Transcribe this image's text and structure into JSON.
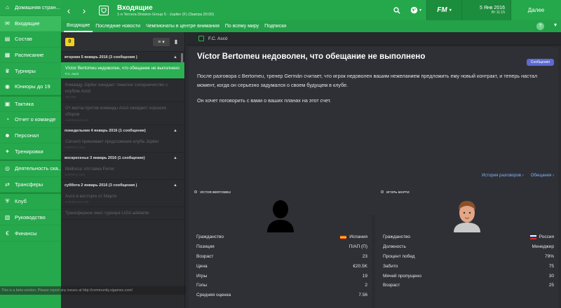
{
  "sidebar": {
    "items": [
      {
        "label": "Домашняя стран...",
        "icon": "home-icon",
        "glyph": "⌂"
      },
      {
        "label": "Входящие",
        "icon": "inbox-icon",
        "glyph": "✉",
        "active": true
      },
      {
        "label": "Состав",
        "icon": "squad-icon",
        "glyph": "▤"
      },
      {
        "label": "Расписание",
        "icon": "calendar-icon",
        "glyph": "▦"
      },
      {
        "label": "Турниры",
        "icon": "trophy-icon",
        "glyph": "♛"
      },
      {
        "label": "Юниоры до 19",
        "icon": "youth-icon",
        "glyph": "◉"
      },
      {
        "label": "Тактика",
        "icon": "tactics-icon",
        "glyph": "▣"
      },
      {
        "label": "Отчет о команде",
        "icon": "report-icon",
        "glyph": "◔"
      },
      {
        "label": "Персонал",
        "icon": "staff-icon",
        "glyph": "☻"
      },
      {
        "label": "Тренировки",
        "icon": "training-icon",
        "glyph": "✦"
      },
      {
        "label": "Деятельность ска...",
        "icon": "scouting-icon",
        "glyph": "◎"
      },
      {
        "label": "Трансферы",
        "icon": "transfers-icon",
        "glyph": "⇄"
      },
      {
        "label": "Клуб",
        "icon": "club-icon",
        "glyph": "⛨"
      },
      {
        "label": "Руководство",
        "icon": "board-icon",
        "glyph": "▥"
      },
      {
        "label": "Финансы",
        "icon": "finances-icon",
        "glyph": "€"
      }
    ]
  },
  "topbar": {
    "title": "Входящие",
    "subtitle": "1-я Tercera Division Group 5 - Jupiter (F) (Завтра 20:00)",
    "date_main": "5 Янв 2016",
    "date_sub": "Вт 11:15",
    "fm_label": "FM",
    "continue_label": "Далее"
  },
  "tabs": [
    "Входящие",
    "Последние новости",
    "Чемпионаты в центре внимания",
    "По всему миру",
    "Подписки"
  ],
  "list": {
    "unread": "0",
    "groups": [
      {
        "header": "вторник 5 январь 2016 (3 сообщения )",
        "messages": [
          {
            "title": "Víctor Bertomeu недоволен, что обещание не выполнено",
            "source": "F.C. Ascó",
            "active": true
          },
          {
            "title": "Команду Júpiter ожидает тяжелое соперничество с клубом Ascó",
            "source": "Sky Bet"
          },
          {
            "title": "От матча против команды Ascó ожидают хороших сборов",
            "source": "worldsoccer.com"
          }
        ]
      },
      {
        "header": "понедельник 4 январь 2016 (1 сообщение)",
        "messages": [
          {
            "title": "Cerveró принимает предложение клуба Júpiter",
            "source": "ESPNFC.com"
          }
        ]
      },
      {
        "header": "воскресенье 3 январь 2016 (1 сообщение)",
        "messages": [
          {
            "title": "Mallorca: отставка Ferrer",
            "source": "ESPNFC.com"
          }
        ]
      },
      {
        "header": "суббота 2 январь 2016 (3 сообщения )",
        "messages": [
          {
            "title": "Ascó в восторге от Марти",
            "source": "worldsoccer.com"
          },
          {
            "title": "Трансферное окно турнира LIGA adelante",
            "source": ""
          }
        ]
      }
    ]
  },
  "main": {
    "club_header": "F.C. Ascó",
    "title": "Víctor Bertomeu недоволен, что обещание не выполнено",
    "tag": "Сообщения",
    "paragraph1": "После разговора с Bertomeu, тренер Germán считает, что игрок недоволен вашим нежеланием предложить ему новый контракт, и теперь настал момент, когда он серьезно задумался о своем будущем в клубе.",
    "paragraph2": "Он хочет поговорить с вами о ваших планах на этот счет.",
    "link1": "История разговоров",
    "link2": "Обещания"
  },
  "left_person": {
    "name": "VÍCTOR BERTOMEU",
    "rows": [
      {
        "label": "Гражданство",
        "value": "Испания",
        "flag": "spain"
      },
      {
        "label": "Позиция",
        "value": "П/АП (П)"
      },
      {
        "label": "Возраст",
        "value": "23"
      },
      {
        "label": "Цена",
        "value": "€20.5K"
      },
      {
        "label": "Игры",
        "value": "19"
      },
      {
        "label": "Голы",
        "value": "2"
      },
      {
        "label": "Средняя оценка",
        "value": "7.56"
      }
    ]
  },
  "right_person": {
    "name": "ИГОРЬ МАРТИ",
    "rows": [
      {
        "label": "Гражданство",
        "value": "Россия",
        "flag": "russia"
      },
      {
        "label": "Должность",
        "value": "Менеджер"
      },
      {
        "label": "Процент побед",
        "value": "79%"
      },
      {
        "label": "Забито",
        "value": "75"
      },
      {
        "label": "Мячей пропущено",
        "value": "30"
      },
      {
        "label": "Возраст",
        "value": "25"
      }
    ]
  },
  "beta_note": "This is a beta version. Please report any issues at http://community.sigames.com/",
  "colors": {
    "accent": "#26a84c",
    "active_msg": "#2cb054",
    "link": "#7fb2ff",
    "tag": "#5c6ad4",
    "badge": "#f2d21b"
  }
}
